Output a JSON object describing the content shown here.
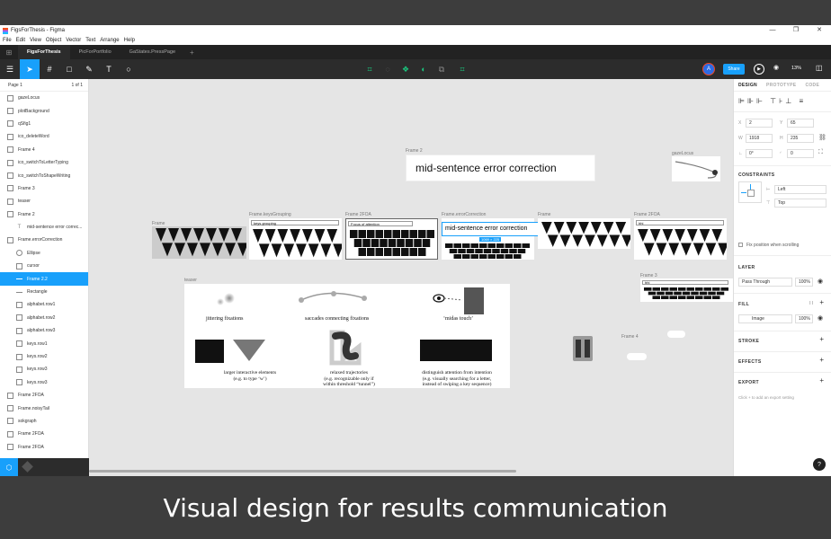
{
  "window": {
    "title": "FigsForThesis - Figma",
    "controls": [
      "—",
      "❐",
      "✕"
    ]
  },
  "menu": [
    "File",
    "Edit",
    "View",
    "Object",
    "Vector",
    "Text",
    "Arrange",
    "Help"
  ],
  "tabs": [
    "FigsForThesis",
    "PicForPortfolio",
    "GaStates.PressPage"
  ],
  "toolbar": {
    "share": "Share",
    "zoom": "13%",
    "avatar": "A"
  },
  "pages": {
    "current": "Page 1",
    "count": "1 of 1"
  },
  "layers": [
    {
      "label": "gazeLocus",
      "indent": 0,
      "icon": "frame"
    },
    {
      "label": "plotBackground",
      "indent": 0,
      "icon": "frame"
    },
    {
      "label": "qSfig1",
      "indent": 0,
      "icon": "frame"
    },
    {
      "label": "ico_deleteWord",
      "indent": 0,
      "icon": "rect"
    },
    {
      "label": "Frame 4",
      "indent": 0,
      "icon": "frame"
    },
    {
      "label": "ico_switchToLetterTyping",
      "indent": 0,
      "icon": "frame"
    },
    {
      "label": "ico_switchToShapeWriting",
      "indent": 0,
      "icon": "frame"
    },
    {
      "label": "Frame 3",
      "indent": 0,
      "icon": "frame"
    },
    {
      "label": "teaser",
      "indent": 0,
      "icon": "frame"
    },
    {
      "label": "Frame 2",
      "indent": 0,
      "icon": "frame"
    },
    {
      "label": "mid-sentence error correc...",
      "indent": 1,
      "icon": "text"
    },
    {
      "label": "Frame.errorCorrection",
      "indent": 0,
      "icon": "frame"
    },
    {
      "label": "Ellipse",
      "indent": 1,
      "icon": "ellipse"
    },
    {
      "label": "cursor",
      "indent": 1,
      "icon": "frame"
    },
    {
      "label": "Frame 2.2",
      "indent": 1,
      "icon": "line",
      "selected": true
    },
    {
      "label": "Rectangle",
      "indent": 1,
      "icon": "line"
    },
    {
      "label": "alphabet.row1",
      "indent": 1,
      "icon": "frame"
    },
    {
      "label": "alphabet.row2",
      "indent": 1,
      "icon": "frame"
    },
    {
      "label": "alphabet.row3",
      "indent": 1,
      "icon": "frame"
    },
    {
      "label": "keys.row1",
      "indent": 1,
      "icon": "frame"
    },
    {
      "label": "keys.row2",
      "indent": 1,
      "icon": "frame"
    },
    {
      "label": "keys.row3",
      "indent": 1,
      "icon": "frame"
    },
    {
      "label": "keys.row3",
      "indent": 1,
      "icon": "frame"
    },
    {
      "label": "Frame 2FOA",
      "indent": 0,
      "icon": "frame"
    },
    {
      "label": "Frame.noisyTail",
      "indent": 0,
      "icon": "frame"
    },
    {
      "label": "sokgraph",
      "indent": 0,
      "icon": "frame"
    },
    {
      "label": "Frame 2FOA",
      "indent": 0,
      "icon": "frame"
    },
    {
      "label": "Frame 2FOA",
      "indent": 0,
      "icon": "frame"
    }
  ],
  "canvas": {
    "frame2_label": "Frame 2",
    "frame2_text": "mid-sentence error correction",
    "gazelocus_label": "gazeLocus",
    "row_labels": [
      "Frame",
      "Frame.keysGrouping",
      "Frame 2FOA",
      "Frame.errorCorrection",
      "Frame",
      "Frame 2FOA"
    ],
    "keysgrouping_input": "keys grouping",
    "focus_input": "Focus of attention",
    "ec_text": "mid-sentence error correction",
    "ec_size": "1069 × 225",
    "hh_text": "hhi",
    "frame3_label": "Frame 3",
    "frame3_text": "hhi",
    "frame4_label": "Frame 4",
    "teaser_label": "teaser",
    "teaser_captions": [
      "jittering fixations",
      "saccades connecting fixations",
      "‘midas touch’"
    ],
    "teaser_captions2": [
      [
        "larger interactive elements",
        "(e.g. to type ‘w’)"
      ],
      [
        "relaxed trajectories",
        "(e.g. recognizable only if",
        "within threshold “tunnel”)"
      ],
      [
        "distinguish attention from intention",
        "(e.g. visually searching for a letter,",
        "instead of swiping a key sequence)"
      ]
    ]
  },
  "design_panel": {
    "tabs": [
      "DESIGN",
      "PROTOTYPE",
      "CODE"
    ],
    "x": "2",
    "y": "65",
    "w": "1918",
    "h": "235",
    "rot": "0°",
    "radius": "0",
    "constraints_title": "CONSTRAINTS",
    "constraint_h": "Left",
    "constraint_v": "Top",
    "fix_label": "Fix position when scrolling",
    "layer_title": "LAYER",
    "blend": "Pass Through",
    "layer_opacity": "100%",
    "fill_title": "FILL",
    "fill_type": "Image",
    "fill_opacity": "100%",
    "stroke_title": "STROKE",
    "effects_title": "EFFECTS",
    "export_title": "EXPORT",
    "export_hint": "Click + to add an export setting"
  },
  "caption": "Visual design for results communication",
  "colors": {
    "accent": "#18a0fb",
    "dark": "#2c2c2c",
    "green": "#1bc47d"
  }
}
